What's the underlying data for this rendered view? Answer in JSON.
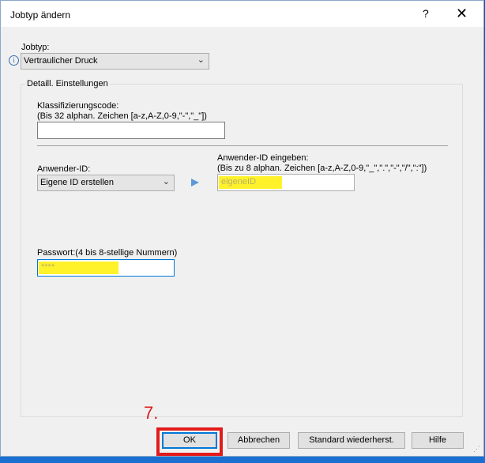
{
  "dialog": {
    "title": "Jobtyp ändern",
    "help_glyph": "?",
    "close_glyph": "✕"
  },
  "jobtype": {
    "label": "Jobtyp:",
    "value": "Vertraulicher Druck"
  },
  "details": {
    "group_title": "Detaill. Einstellungen",
    "classification": {
      "label_line1": "Klassifizierungscode:",
      "label_line2": "(Bis 32 alphan. Zeichen [a-z,A-Z,0-9,\"-\",\"_\"])",
      "value": ""
    },
    "user_id": {
      "label": "Anwender-ID:",
      "value": "Eigene ID erstellen"
    },
    "user_id_input": {
      "label_line1": "Anwender-ID eingeben:",
      "label_line2": "(Bis zu 8 alphan. Zeichen [a-z,A-Z,0-9,\"_\",\".\",\"-\",\"/\",\":\"])",
      "value": "eigeneID"
    },
    "password": {
      "label": "Passwort:(4 bis 8-stellige Nummern)",
      "value": "****"
    }
  },
  "annotation": {
    "step": "7."
  },
  "buttons": {
    "ok": "OK",
    "cancel": "Abbrechen",
    "defaults": "Standard wiederherst.",
    "help": "Hilfe"
  },
  "colors": {
    "highlight": "#fff22a",
    "annotation_red": "#e21b1b",
    "focus_blue": "#0078d7"
  }
}
